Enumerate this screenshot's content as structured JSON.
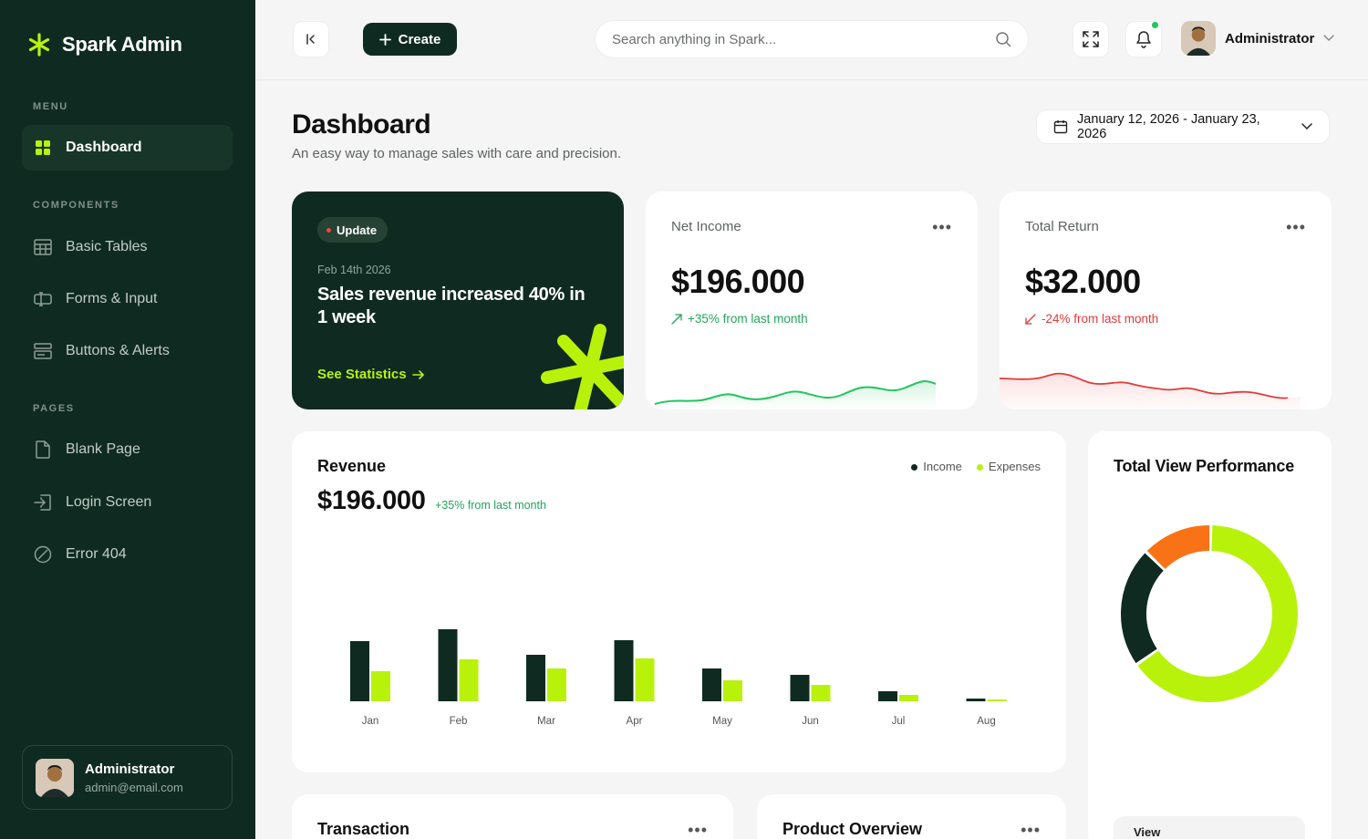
{
  "app": {
    "brand": "Spark Admin"
  },
  "sidebar": {
    "sections": {
      "menu": "MENU",
      "components": "COMPONENTS",
      "pages": "PAGES"
    },
    "items": [
      {
        "label": "Dashboard",
        "icon": "grid-icon",
        "active": true
      },
      {
        "label": "Basic Tables",
        "icon": "table-icon"
      },
      {
        "label": "Forms & Input",
        "icon": "form-input-icon"
      },
      {
        "label": "Buttons & Alerts",
        "icon": "buttons-icon"
      },
      {
        "label": "Blank Page",
        "icon": "file-icon"
      },
      {
        "label": "Login Screen",
        "icon": "login-icon"
      },
      {
        "label": "Error 404",
        "icon": "error-icon"
      }
    ],
    "user": {
      "name": "Administrator",
      "email": "admin@email.com"
    }
  },
  "topbar": {
    "create_label": "Create",
    "search_placeholder": "Search anything in Spark...",
    "profile_name": "Administrator"
  },
  "header": {
    "title": "Dashboard",
    "subtitle": "An easy way to manage sales with care and precision.",
    "date_range": "January 12, 2026 - January 23, 2026"
  },
  "update_card": {
    "badge": "Update",
    "date": "Feb 14th 2026",
    "headline": "Sales revenue increased 40% in 1 week",
    "link": "See Statistics"
  },
  "net_income": {
    "label": "Net Income",
    "value": "$196.000",
    "change": "+35% from last month"
  },
  "total_return": {
    "label": "Total Return",
    "value": "$32.000",
    "change": "-24% from last month"
  },
  "revenue": {
    "title": "Revenue",
    "value": "$196.000",
    "change": "+35% from last month",
    "legend": {
      "income": "Income",
      "expenses": "Expenses"
    }
  },
  "total_view": {
    "title": "Total View Performance",
    "pill_label": "View"
  },
  "bottom": {
    "transaction": "Transaction",
    "product_overview": "Product Overview"
  },
  "colors": {
    "primary": "#0f2b21",
    "accent": "#b8f20b",
    "orange": "#f97316",
    "green": "#22c55e",
    "red": "#ef4444"
  },
  "chart_data": [
    {
      "type": "bar",
      "title": "Revenue",
      "categories": [
        "Jan",
        "Feb",
        "Mar",
        "Apr",
        "May",
        "Jun",
        "Jul",
        "Aug"
      ],
      "series": [
        {
          "name": "Income",
          "values": [
            66,
            79,
            51,
            67,
            36,
            29,
            11,
            3
          ]
        },
        {
          "name": "Expenses",
          "values": [
            33,
            46,
            36,
            47,
            23,
            18,
            7,
            2
          ]
        }
      ],
      "ylim": [
        0,
        100
      ]
    },
    {
      "type": "pie",
      "title": "Total View Performance",
      "slices": [
        {
          "value": 65,
          "color": "#b8f20b"
        },
        {
          "value": 22,
          "color": "#0f2b21"
        },
        {
          "value": 13,
          "color": "#f97316"
        }
      ]
    }
  ]
}
